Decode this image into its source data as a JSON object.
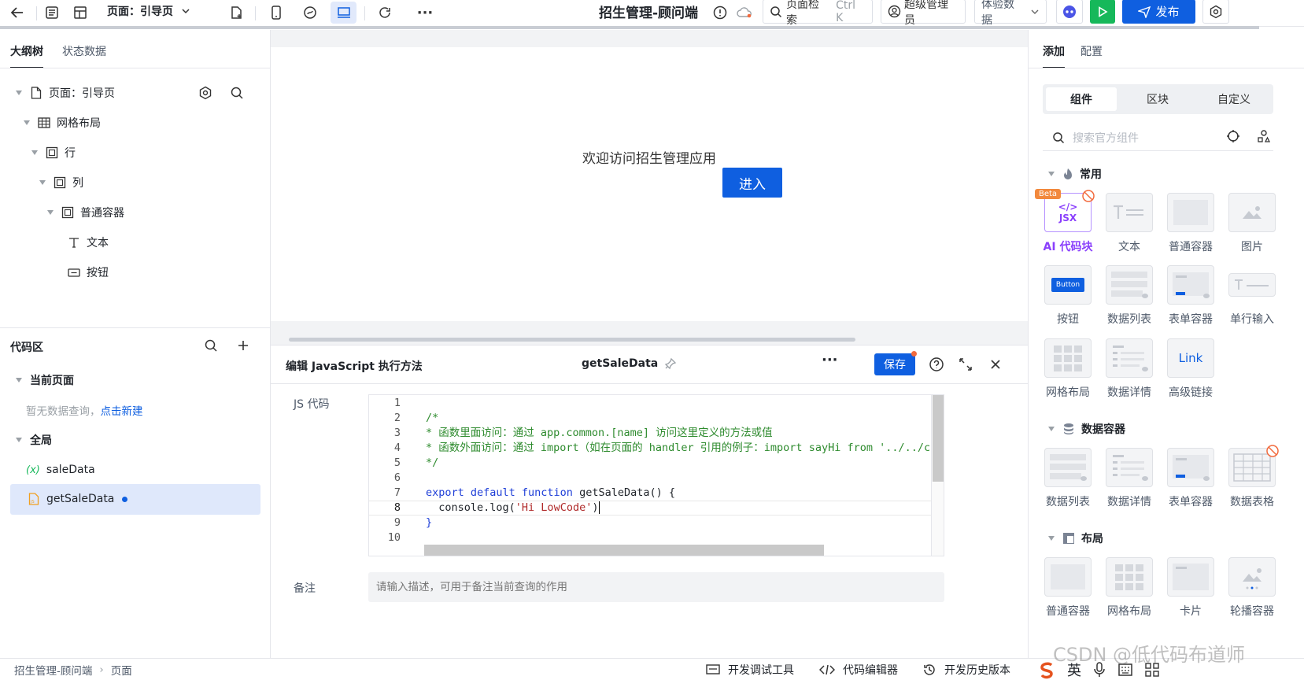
{
  "topbar": {
    "page_selector": "页面：引导页",
    "app_title": "招生管理-顾问端",
    "search_label": "页面检索",
    "search_shortcut": "Ctrl K",
    "user_label": "超级管理员",
    "env_label": "体验数据",
    "publish_label": "发布"
  },
  "outline": {
    "tabs": [
      {
        "label": "大纲树"
      },
      {
        "label": "状态数据"
      }
    ],
    "tree": [
      {
        "label": "页面：引导页",
        "icon": "page-icon"
      },
      {
        "label": "网格布局",
        "icon": "grid-icon"
      },
      {
        "label": "行",
        "icon": "row-icon"
      },
      {
        "label": "列",
        "icon": "column-icon"
      },
      {
        "label": "普通容器",
        "icon": "container-icon"
      },
      {
        "label": "文本",
        "icon": "text-icon"
      },
      {
        "label": "按钮",
        "icon": "button-icon"
      }
    ]
  },
  "codearea": {
    "title": "代码区",
    "current_page": "当前页面",
    "empty_text": "暂无数据查询，",
    "create_link": "点击新建",
    "global": "全局",
    "items": [
      {
        "label": "saleData",
        "icon": "variable-icon"
      },
      {
        "label": "getSaleData",
        "icon": "js-file-icon"
      }
    ]
  },
  "artboard": {
    "welcome": "欢迎访问招生管理应用",
    "enter_button": "进入"
  },
  "editor": {
    "title": "编辑 JavaScript 执行方法",
    "function_name": "getSaleData",
    "save_label": "保存",
    "js_label": "JS 代码",
    "remark_label": "备注",
    "remark_placeholder": "请输入描述，可用于备注当前查询的作用",
    "lines": [
      {
        "n": "1",
        "text": ""
      },
      {
        "n": "2",
        "text": "/*"
      },
      {
        "n": "3",
        "text": "* 函数里面访问：通过 app.common.[name] 访问这里定义的方法或值"
      },
      {
        "n": "4",
        "text": "* 函数外面访问：通过 import（如在页面的 handler 引用的例子：import sayHi from '../../c"
      },
      {
        "n": "5",
        "text": "*/"
      },
      {
        "n": "6",
        "text": ""
      },
      {
        "n": "7",
        "kw1": "export default function",
        "rest": " getSaleData() {"
      },
      {
        "n": "8",
        "pre": "  console.log(",
        "str": "'Hi LowCode'",
        "post": ")"
      },
      {
        "n": "9",
        "text": "}"
      },
      {
        "n": "10",
        "text": ""
      }
    ]
  },
  "palette": {
    "tabs": [
      {
        "label": "添加"
      },
      {
        "label": "配置"
      }
    ],
    "segments": [
      {
        "label": "组件"
      },
      {
        "label": "区块"
      },
      {
        "label": "自定义"
      }
    ],
    "search_placeholder": "搜索官方组件",
    "sections": [
      {
        "title": "常用",
        "items": [
          {
            "label": "AI 代码块",
            "badge": "Beta",
            "icon_text": "JSX"
          },
          {
            "label": "文本"
          },
          {
            "label": "普通容器"
          },
          {
            "label": "图片"
          },
          {
            "label": "按钮",
            "icon_text": "Button"
          },
          {
            "label": "数据列表"
          },
          {
            "label": "表单容器"
          },
          {
            "label": "单行输入"
          },
          {
            "label": "网格布局"
          },
          {
            "label": "数据详情"
          },
          {
            "label": "高级链接",
            "icon_text": "Link"
          }
        ]
      },
      {
        "title": "数据容器",
        "items": [
          {
            "label": "数据列表"
          },
          {
            "label": "数据详情"
          },
          {
            "label": "表单容器"
          },
          {
            "label": "数据表格"
          }
        ]
      },
      {
        "title": "布局",
        "items": [
          {
            "label": "普通容器"
          },
          {
            "label": "网格布局"
          },
          {
            "label": "卡片"
          },
          {
            "label": "轮播容器"
          }
        ]
      }
    ]
  },
  "footer": {
    "breadcrumb": [
      {
        "label": "招生管理-顾问端"
      },
      {
        "label": "页面"
      }
    ],
    "tools": [
      {
        "label": "开发调试工具"
      },
      {
        "label": "代码编辑器"
      },
      {
        "label": "开发历史版本"
      }
    ],
    "ime_label": "英",
    "watermark": "CSDN @低代码布道师"
  },
  "colors": {
    "primary": "#0f5fe0",
    "green": "#16b85a",
    "ai_purple": "#8a3ffc"
  }
}
